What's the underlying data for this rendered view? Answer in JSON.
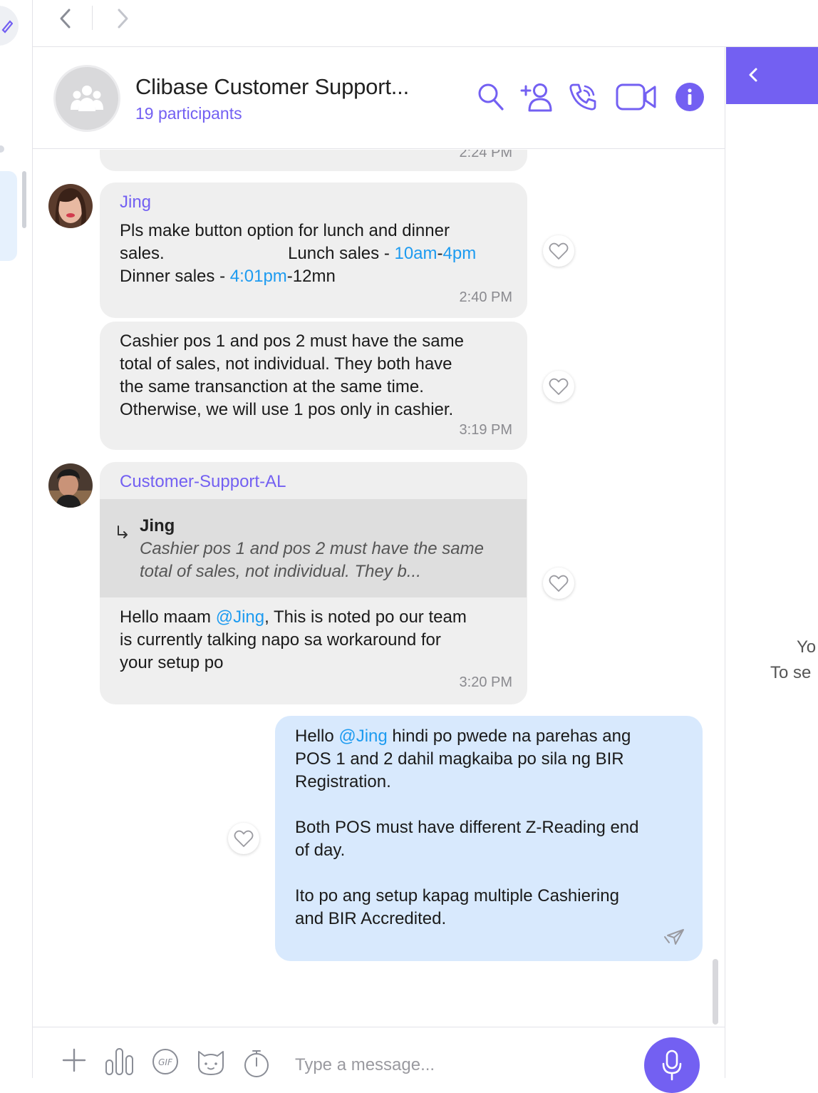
{
  "chat": {
    "title": "Clibase Customer Support...",
    "participants": "19 participants"
  },
  "header_icons": [
    "search-icon",
    "add-participant-icon",
    "call-icon",
    "video-call-icon",
    "info-icon"
  ],
  "messages": {
    "partial_time": "2:24 PM",
    "m1": {
      "sender": "Jing",
      "line1": "Pls make button option for lunch and dinner",
      "line2_a": "sales.                          Lunch sales - ",
      "line2_link1": "10am",
      "line2_dash": "-",
      "line2_link2": "4pm",
      "line3_a": "Dinner sales - ",
      "line3_link": "4:01pm",
      "line3_b": "-12mn",
      "time": "2:40 PM"
    },
    "m2": {
      "text": "Cashier pos 1 and pos 2 must have the same\ntotal of sales, not individual. They both have\nthe same transanction at the same time.\nOtherwise, we will use 1 pos only in cashier.",
      "time": "3:19 PM"
    },
    "m3": {
      "sender": "Customer-Support-AL",
      "quote_sender": "Jing",
      "quote_text": "Cashier pos 1 and pos 2 must have the same total of sales, not individual. They b...",
      "text_a": "Hello maam ",
      "mention": "@Jing",
      "text_b": ", This is noted po our team\nis currently talking napo sa workaround for\nyour setup po",
      "time": "3:20 PM"
    },
    "m4": {
      "text_a": "Hello ",
      "mention": "@Jing",
      "text_b": " hindi po pwede na parehas ang\nPOS 1 and 2 dahil magkaiba po sila ng BIR\nRegistration.\n\nBoth POS must have different Z-Reading end\nof day.\n\nIto po ang setup kapag multiple Cashiering\nand BIR Accredited."
    }
  },
  "right_panel": {
    "line1": "Yo",
    "line2": "To se"
  },
  "composer": {
    "placeholder": "Type a message..."
  },
  "colors": {
    "accent": "#7360f2",
    "link": "#1d9bf0",
    "incoming_bubble": "#efefef",
    "outgoing_bubble": "#d8e9fd"
  }
}
